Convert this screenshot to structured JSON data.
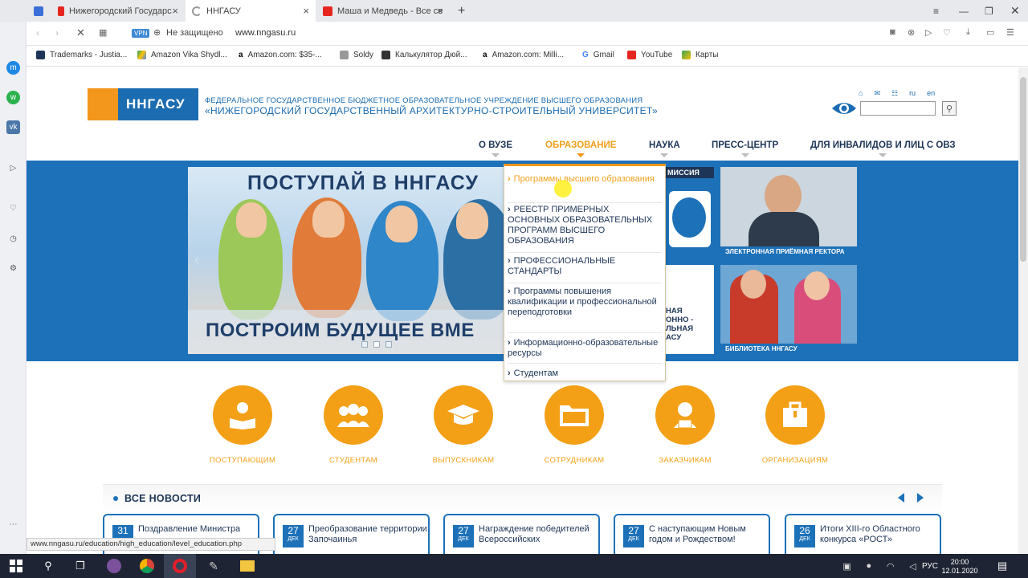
{
  "browser": {
    "tabs": [
      {
        "label": "",
        "icon": "mail-icon"
      },
      {
        "label": "Нижегородский Государс",
        "icon": "yandex-icon"
      },
      {
        "label": "ННГАСУ",
        "icon": "loading-icon"
      },
      {
        "label": "Маша и Медведь - Все се",
        "icon": "youtube-icon"
      }
    ],
    "vpn": "VPN",
    "security": "Не защищено",
    "url": "www.nngasu.ru",
    "bookmarks": [
      "Trademarks - Justia...",
      "Amazon Vika Shydl...",
      "Amazon.com: $35-...",
      "Soldy",
      "Калькулятор Дюй...",
      "Amazon.com: Milli...",
      "Gmail",
      "YouTube",
      "Карты"
    ]
  },
  "header": {
    "logo_text": "ННГАСУ",
    "org_line1": "ФЕДЕРАЛЬНОЕ ГОСУДАРСТВЕННОЕ БЮДЖЕТНОЕ ОБРАЗОВАТЕЛЬНОЕ УЧРЕЖДЕНИЕ ВЫСШЕГО ОБРАЗОВАНИЯ",
    "org_line2": "«НИЖЕГОРОДСКИЙ ГОСУДАРСТВЕННЫЙ АРХИТЕКТУРНО-СТРОИТЕЛЬНЫЙ УНИВЕРСИТЕТ»",
    "lang_ru": "ru",
    "lang_en": "en"
  },
  "nav": [
    "О ВУЗЕ",
    "ОБРАЗОВАНИЕ",
    "НАУКА",
    "ПРЕСС-ЦЕНТР",
    "ДЛЯ ИНВАЛИДОВ И ЛИЦ С ОВЗ"
  ],
  "slider": {
    "title": "ПОСТУПАЙ В ННГАСУ",
    "bottom": "ПОСТРОИМ БУДУЩЕЕ ВМЕ"
  },
  "tiles": {
    "commission": "МИССИЯ",
    "rector": "ЭЛЕКТРОННАЯ ПРИЁМНАЯ РЕКТОРА",
    "partial": [
      "НАЯ",
      "ОННО -",
      "ЛЬНАЯ",
      "АСУ"
    ],
    "library": "БИБЛИОТЕКА ННГАСУ"
  },
  "dropdown": [
    "Программы высшего образования",
    "РЕЕСТР ПРИМЕРНЫХ ОСНОВНЫХ ОБРАЗОВАТЕЛЬНЫХ ПРОГРАММ ВЫСШЕГО ОБРАЗОВАНИЯ",
    "ПРОФЕССИОНАЛЬНЫЕ СТАНДАРТЫ",
    "Программы повышения квалификации и профессиональной переподготовки",
    "Информационно-образовательные ресурсы",
    "Студентам"
  ],
  "audiences": [
    "ПОСТУПАЮЩИМ",
    "СТУДЕНТАМ",
    "ВЫПУСКНИКАМ",
    "СОТРУДНИКАМ",
    "ЗАКАЗЧИКАМ",
    "ОРГАНИЗАЦИЯМ"
  ],
  "news": {
    "title": "ВСЕ НОВОСТИ",
    "items": [
      {
        "day": "31",
        "month": "",
        "text": "Поздравление Министра"
      },
      {
        "day": "27",
        "month": "ДЕК",
        "text": "Преобразование территории Започаинья"
      },
      {
        "day": "27",
        "month": "ДЕК",
        "text": "Награждение победителей Всероссийских"
      },
      {
        "day": "27",
        "month": "ДЕК",
        "text": "С наступающим Новым годом и Рождеством!"
      },
      {
        "day": "26",
        "month": "ДЕК",
        "text": "Итоги XIII-го Областного конкурса «РОСТ»"
      }
    ]
  },
  "status_url": "www.nngasu.ru/education/high_education/level_education.php",
  "taskbar": {
    "lang": "РУС",
    "time": "20:00",
    "date": "12.01.2020"
  }
}
